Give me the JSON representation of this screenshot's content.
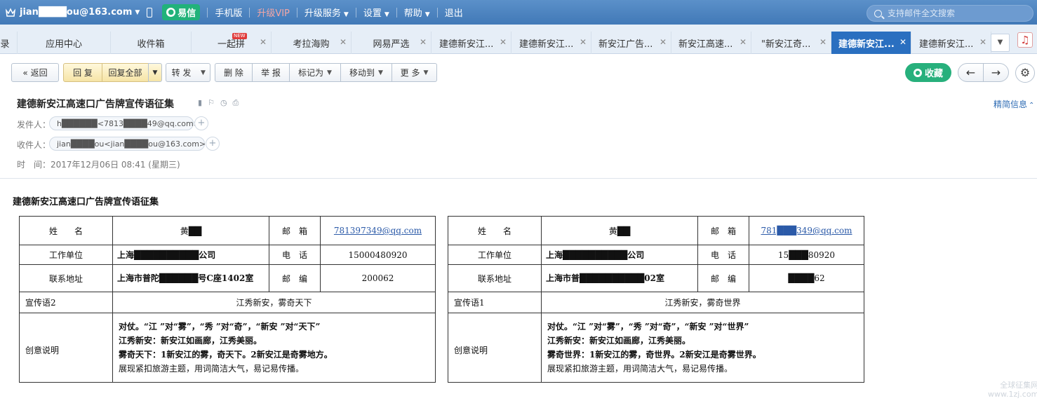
{
  "topbar": {
    "user": "jian████ou@163.com",
    "yixin": "易信",
    "links": [
      "手机版",
      "升级VIP",
      "升级服务",
      "设置",
      "帮助",
      "退出"
    ],
    "search_placeholder": "支持邮件全文搜索"
  },
  "tabs": [
    {
      "label": "录"
    },
    {
      "label": "应用中心"
    },
    {
      "label": "收件箱"
    },
    {
      "label": "一起拼",
      "badge": "NEW"
    },
    {
      "label": "考拉海购"
    },
    {
      "label": "网易严选"
    },
    {
      "label": "建德新安江..."
    },
    {
      "label": "建德新安江..."
    },
    {
      "label": "新安江广告..."
    },
    {
      "label": "新安江高速..."
    },
    {
      "label": "\"新安江奇..."
    },
    {
      "label": "建德新安江..."
    },
    {
      "label": "建德新安江..."
    }
  ],
  "toolbar": {
    "back": "返回",
    "reply": "回 复",
    "reply_all": "回复全部",
    "forward": "转 发",
    "delete": "删 除",
    "report": "举 报",
    "mark_as": "标记为",
    "move_to": "移动到",
    "more": "更 多",
    "favorite": "收藏"
  },
  "mail": {
    "subject": "建德新安江高速口广告牌宣传语征集",
    "simple_info": "精简信息",
    "from_label": "发件人：",
    "from_addr": "h██████<7813████49@qq.com>",
    "to_label": "收件人：",
    "to_addr": "jian████ou<jian████ou@163.com>",
    "time_label": "时　间：",
    "time": "2017年12月06日 08:41 (星期三)"
  },
  "body": {
    "title": "建德新安江高速口广告牌宣传语征集",
    "labels": {
      "name": "姓　　名",
      "email": "邮　箱",
      "org": "工作单位",
      "phone": "电　话",
      "address": "联系地址",
      "zip": "邮　编",
      "desc": "创意说明"
    },
    "entries": [
      {
        "name": "黄██",
        "email": "781397349@qq.com",
        "org": "上海██████████公司",
        "phone": "15000480920",
        "address": "上海市普陀██████号C座1402室",
        "zip": "200062",
        "slogan_label": "宣传语2",
        "slogan": "江秀新安，雾奇天下",
        "desc": [
          "对仗。“江 ”对“雾”，“秀 ”对“奇”，“新安 ”对“天下”",
          "江秀新安：新安江如画廊，江秀美丽。",
          "雾奇天下：1新安江的雾，奇天下。2新安江是奇雾地方。",
          "展现紧扣旅游主题，用词简洁大气，易记易传播。"
        ]
      },
      {
        "name": "黄██",
        "email": "781███349@qq.com",
        "org": "上海██████████公司",
        "phone": "15███80920",
        "address": "上海市普██████████02室",
        "zip": "████62",
        "slogan_label": "宣传语1",
        "slogan": "江秀新安，雾奇世界",
        "desc": [
          "对仗。“江 ”对“雾”，“秀 ”对“奇”，“新安 ”对“世界”",
          "江秀新安：新安江如画廊，江秀美丽。",
          "雾奇世界：1新安江的雾，奇世界。2新安江是奇雾世界。",
          "展现紧扣旅游主题，用词简洁大气，易记易传播。"
        ]
      }
    ]
  },
  "watermark": "全球征集网\nwww.1zj.com"
}
